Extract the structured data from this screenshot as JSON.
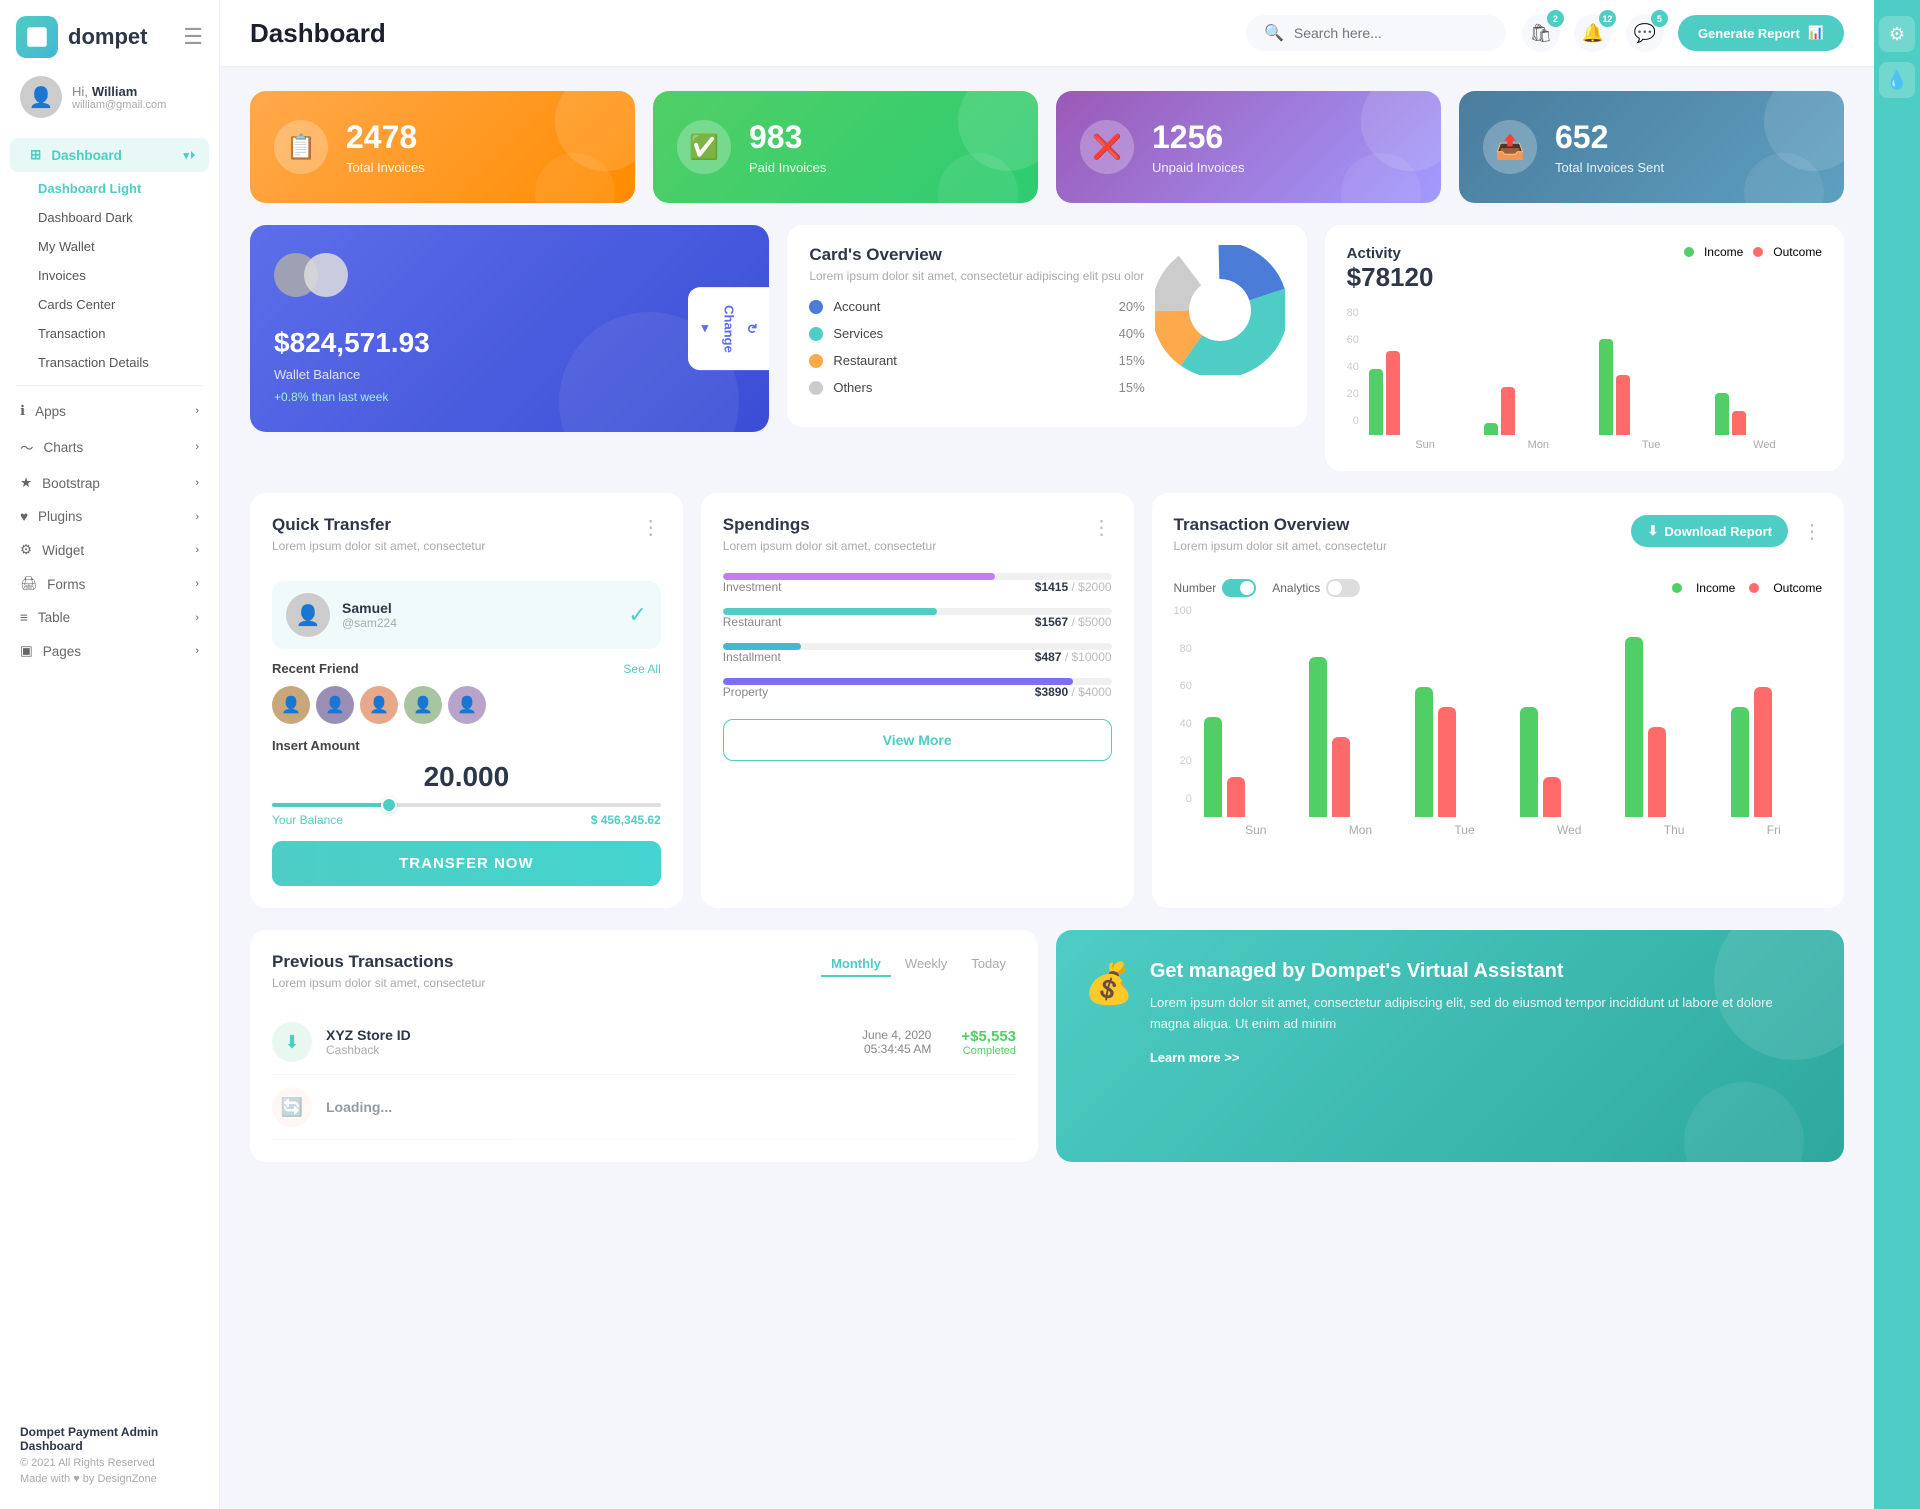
{
  "app": {
    "name": "dompet",
    "title": "Dashboard"
  },
  "header": {
    "search_placeholder": "Search here...",
    "generate_btn": "Generate Report",
    "badges": {
      "cart": "2",
      "bell": "12",
      "chat": "5"
    }
  },
  "user": {
    "greeting": "Hi,",
    "name": "William",
    "email": "william@gmail.com"
  },
  "sidebar": {
    "dashboard_items": [
      {
        "label": "Dashboard",
        "active": true
      },
      {
        "label": "Dashboard Light",
        "sub": true,
        "active_sub": true
      },
      {
        "label": "Dashboard Dark",
        "sub": true
      },
      {
        "label": "My Wallet",
        "sub": true
      },
      {
        "label": "Invoices",
        "sub": true
      },
      {
        "label": "Cards Center",
        "sub": true
      },
      {
        "label": "Transaction",
        "sub": true
      },
      {
        "label": "Transaction Details",
        "sub": true
      }
    ],
    "nav_items": [
      {
        "label": "Apps",
        "arrow": true
      },
      {
        "label": "Charts",
        "arrow": true
      },
      {
        "label": "Bootstrap",
        "arrow": true
      },
      {
        "label": "Plugins",
        "arrow": true
      },
      {
        "label": "Widget",
        "arrow": true
      },
      {
        "label": "Forms",
        "arrow": true
      },
      {
        "label": "Table",
        "arrow": true
      },
      {
        "label": "Pages",
        "arrow": true
      }
    ],
    "footer": {
      "title": "Dompet Payment Admin Dashboard",
      "copy": "© 2021 All Rights Reserved",
      "made": "Made with ♥ by DesignZone"
    }
  },
  "stats": [
    {
      "label": "Total Invoices",
      "value": "2478",
      "color": "orange",
      "icon": "📋"
    },
    {
      "label": "Paid Invoices",
      "value": "983",
      "color": "green",
      "icon": "✅"
    },
    {
      "label": "Unpaid Invoices",
      "value": "1256",
      "color": "purple",
      "icon": "❌"
    },
    {
      "label": "Total Invoices Sent",
      "value": "652",
      "color": "teal",
      "icon": "📤"
    }
  ],
  "wallet": {
    "amount": "$824,571.93",
    "label": "Wallet Balance",
    "change": "+0.8% than last week",
    "change_btn": "Change"
  },
  "cards_overview": {
    "title": "Card's Overview",
    "subtitle": "Lorem ipsum dolor sit amet, consectetur adipiscing elit psu olor",
    "items": [
      {
        "label": "Account",
        "pct": "20%",
        "color": "#4a7cd8"
      },
      {
        "label": "Services",
        "pct": "40%",
        "color": "#4ecdc4"
      },
      {
        "label": "Restaurant",
        "pct": "15%",
        "color": "#ffa94d"
      },
      {
        "label": "Others",
        "pct": "15%",
        "color": "#ccc"
      }
    ]
  },
  "activity": {
    "title": "Activity",
    "amount": "$78120",
    "legend": [
      {
        "label": "Income",
        "color": "#51cf66"
      },
      {
        "label": "Outcome",
        "color": "#ff6b6b"
      }
    ],
    "bars": [
      {
        "day": "Sun",
        "income": 55,
        "outcome": 70
      },
      {
        "day": "Mon",
        "income": 10,
        "outcome": 40
      },
      {
        "day": "Tue",
        "income": 80,
        "outcome": 50
      },
      {
        "day": "Wed",
        "income": 35,
        "outcome": 20
      }
    ],
    "y_labels": [
      "80",
      "60",
      "40",
      "20",
      "0"
    ]
  },
  "quick_transfer": {
    "title": "Quick Transfer",
    "subtitle": "Lorem ipsum dolor sit amet, consectetur",
    "user": {
      "name": "Samuel",
      "handle": "@sam224"
    },
    "recent_friends_label": "Recent Friend",
    "see_all": "See All",
    "insert_amount_label": "Insert Amount",
    "amount": "20.000",
    "balance_label": "Your Balance",
    "balance_value": "$ 456,345.62",
    "transfer_btn": "TRANSFER NOW"
  },
  "spendings": {
    "title": "Spendings",
    "subtitle": "Lorem ipsum dolor sit amet, consectetur",
    "items": [
      {
        "label": "Investment",
        "current": "$1415",
        "max": "$2000",
        "pct": 70,
        "color": "#c47ef5"
      },
      {
        "label": "Restaurant",
        "current": "$1567",
        "max": "$5000",
        "pct": 55,
        "color": "#4ecdc4"
      },
      {
        "label": "Installment",
        "current": "$487",
        "max": "$10000",
        "pct": 20,
        "color": "#45b7d1"
      },
      {
        "label": "Property",
        "current": "$3890",
        "max": "$4000",
        "pct": 90,
        "color": "#7c6ef5"
      }
    ],
    "view_more_btn": "View More"
  },
  "transaction_overview": {
    "title": "Transaction Overview",
    "subtitle": "Lorem ipsum dolor sit amet, consectetur",
    "download_btn": "Download Report",
    "toggle_number": "Number",
    "toggle_analytics": "Analytics",
    "legend": [
      {
        "label": "Income",
        "color": "#51cf66"
      },
      {
        "label": "Outcome",
        "color": "#ff6b6b"
      }
    ],
    "bars": [
      {
        "day": "Sun",
        "income": 50,
        "outcome": 20
      },
      {
        "day": "Mon",
        "income": 80,
        "outcome": 40
      },
      {
        "day": "Tue",
        "income": 65,
        "outcome": 55
      },
      {
        "day": "Wed",
        "income": 55,
        "outcome": 20
      },
      {
        "day": "Thu",
        "income": 90,
        "outcome": 45
      },
      {
        "day": "Fri",
        "income": 55,
        "outcome": 65
      }
    ],
    "y_labels": [
      "100",
      "80",
      "60",
      "40",
      "20",
      "0"
    ]
  },
  "previous_transactions": {
    "title": "Previous Transactions",
    "subtitle": "Lorem ipsum dolor sit amet, consectetur",
    "tabs": [
      "Monthly",
      "Weekly",
      "Today"
    ],
    "active_tab": "Monthly",
    "rows": [
      {
        "name": "XYZ Store ID",
        "sub": "Cashback",
        "date": "June 4, 2020",
        "time": "05:34:45 AM",
        "amount": "+$5,553",
        "status": "Completed",
        "icon": "⬇"
      }
    ]
  },
  "virtual_assistant": {
    "title": "Get managed by Dompet's Virtual Assistant",
    "desc": "Lorem ipsum dolor sit amet, consectetur adipiscing elit, sed do eiusmod tempor incididunt ut labore et dolore magna aliqua. Ut enim ad minim",
    "link": "Learn more >>"
  }
}
